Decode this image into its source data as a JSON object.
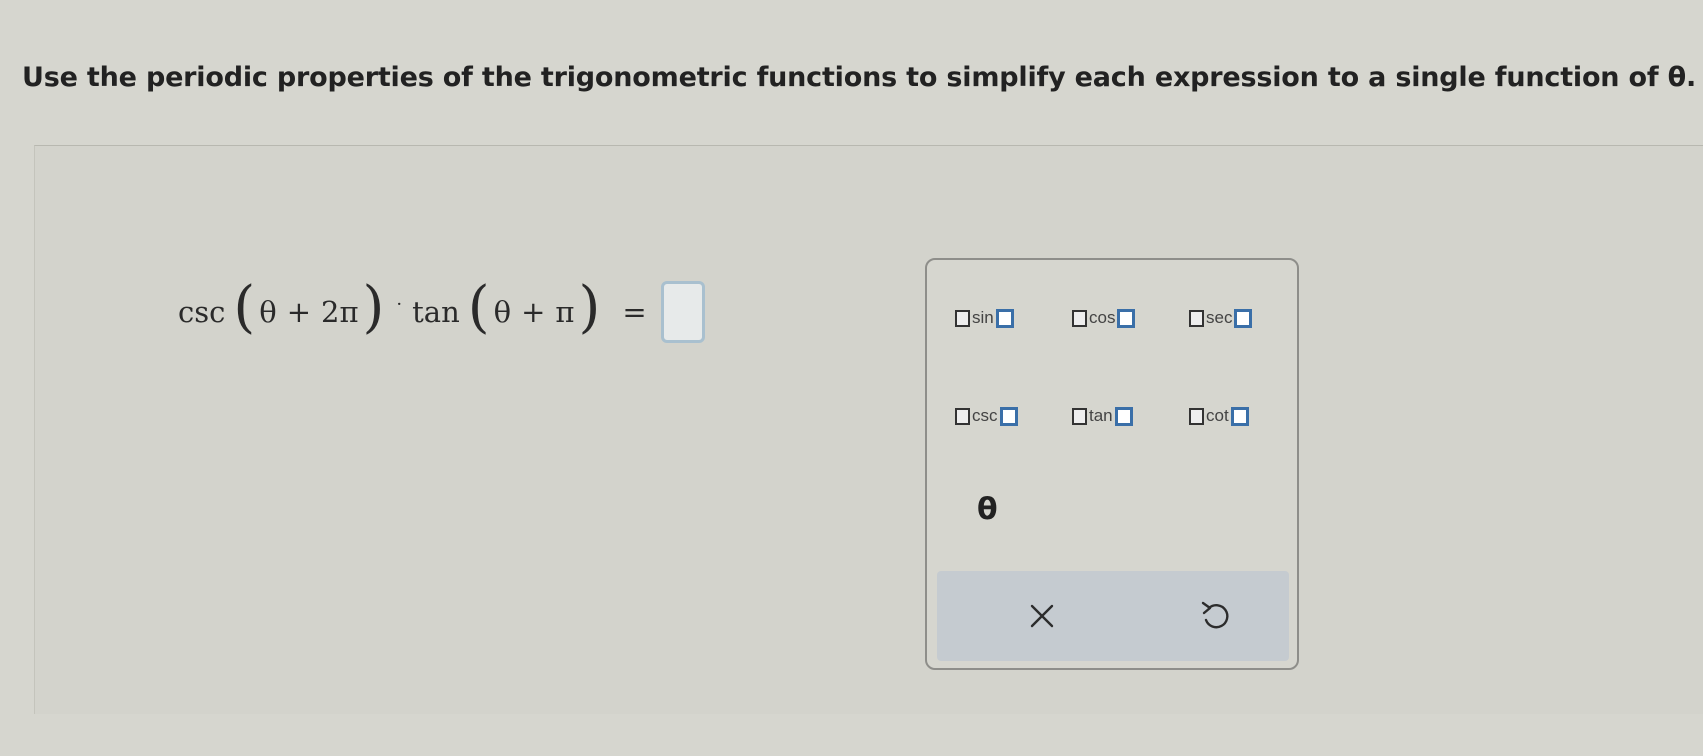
{
  "instruction": "Use the periodic properties of the trigonometric functions to simplify each expression to a single function of θ.",
  "expression": {
    "fn1": "csc",
    "arg1_var": "θ",
    "arg1_op": "+",
    "arg1_const": "2π",
    "product_dot": "·",
    "fn2": "tan",
    "arg2_var": "θ",
    "arg2_op": "+",
    "arg2_const": "π",
    "equals": "="
  },
  "palette": {
    "buttons": [
      {
        "label": "sin"
      },
      {
        "label": "cos"
      },
      {
        "label": "sec"
      },
      {
        "label": "csc"
      },
      {
        "label": "tan"
      },
      {
        "label": "cot"
      }
    ],
    "theta_label": "θ",
    "clear_icon": "close-icon",
    "undo_icon": "undo-icon"
  },
  "colors": {
    "answer_box_border": "#a9c0cf",
    "palette_square_blue": "#3a6fa8",
    "action_bar": "#c5cbd0"
  }
}
